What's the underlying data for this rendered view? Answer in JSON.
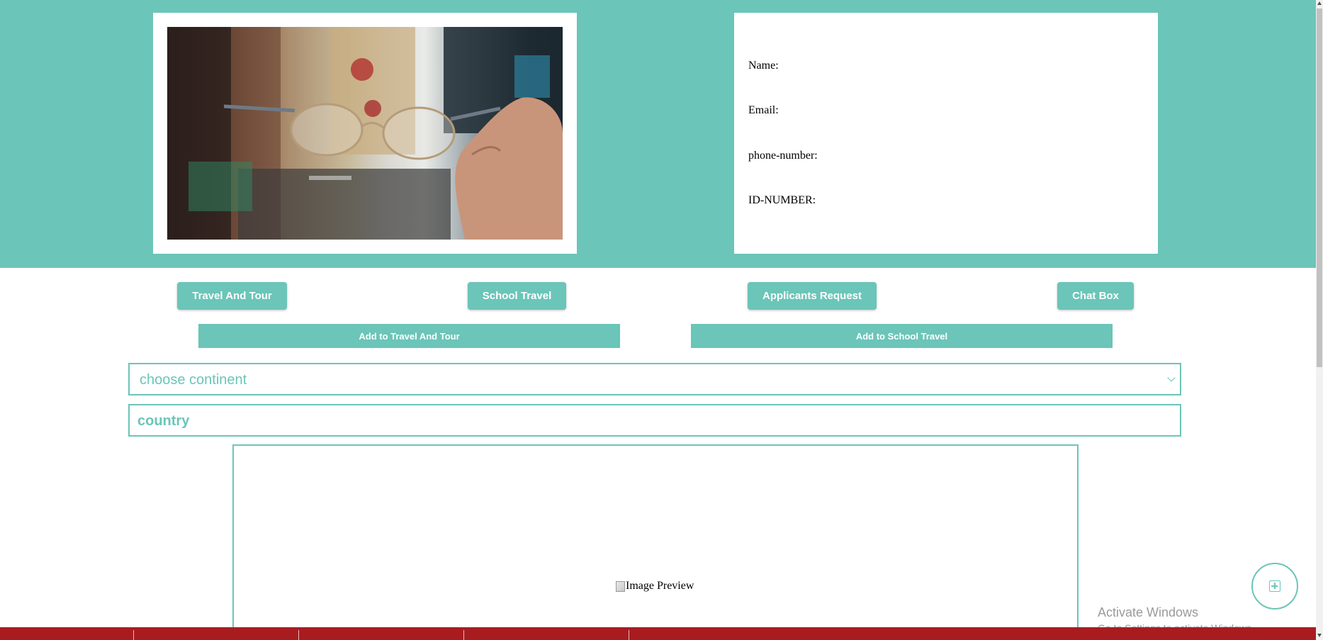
{
  "profile": {
    "name_label": "Name:",
    "email_label": "Email:",
    "phone_label": "phone-number:",
    "id_label": "ID-NUMBER:"
  },
  "nav": {
    "travel_and_tour": "Travel And Tour",
    "school_travel": "School Travel",
    "applicants_request": "Applicants Request",
    "chat_box": "Chat Box"
  },
  "actions": {
    "add_travel_and_tour": "Add to Travel And Tour",
    "add_school_travel": "Add to School Travel"
  },
  "form": {
    "continent_selected": "choose continent",
    "country_placeholder": "country"
  },
  "preview": {
    "alt_text": "Image Preview"
  },
  "windows_watermark": {
    "line1": "Activate Windows",
    "line2": "Go to Settings to activate Windows."
  },
  "colors": {
    "accent": "#6bc5b8",
    "footer": "#a81c20"
  },
  "icons": {
    "fab": "add-square-icon",
    "select": "chevron-down-icon"
  }
}
